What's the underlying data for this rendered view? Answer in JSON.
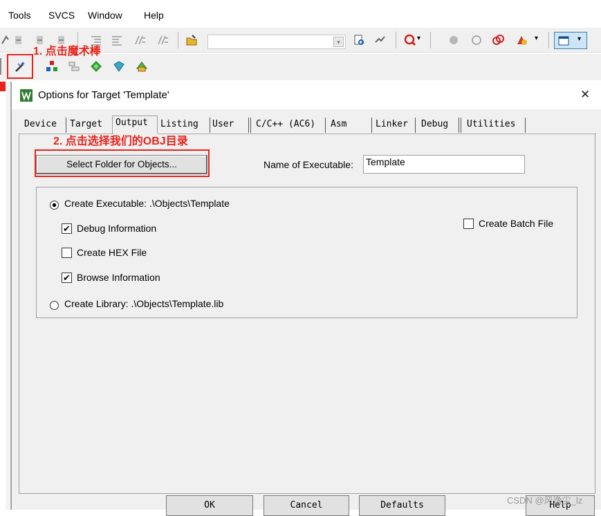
{
  "menubar": {
    "items": [
      "Tools",
      "SVCS",
      "Window",
      "Help"
    ]
  },
  "annotations": {
    "step1": "1. 点击魔术棒",
    "step2": "2. 点击选择我们的OBJ目录"
  },
  "dialog": {
    "title": "Options for Target 'Template'",
    "close": "✕",
    "tabs": [
      "Device",
      "Target",
      "Output",
      "Listing",
      "User",
      "C/C++ (AC6)",
      "Asm",
      "Linker",
      "Debug",
      "Utilities"
    ],
    "active_tab": "Output",
    "select_folder_label": "Select Folder for Objects...",
    "name_of_executable_label": "Name of Executable:",
    "name_of_executable_value": "Template",
    "create_executable_label": "Create Executable:  .\\Objects\\Template",
    "debug_info_label": "Debug Information",
    "create_hex_label": "Create HEX File",
    "browse_info_label": "Browse Information",
    "create_library_label": "Create Library:  .\\Objects\\Template.lib",
    "create_batch_label": "Create Batch File",
    "checks": {
      "debug_info": true,
      "create_hex": false,
      "browse_info": true,
      "create_batch": false
    },
    "radio_selected": "create_executable",
    "buttons": {
      "ok": "OK",
      "cancel": "Cancel",
      "defaults": "Defaults",
      "help": "Help"
    }
  },
  "watermark": "CSDN @风逸尘_lz",
  "colors": {
    "annotation": "#e8231b",
    "accent": "#0a66c2"
  }
}
